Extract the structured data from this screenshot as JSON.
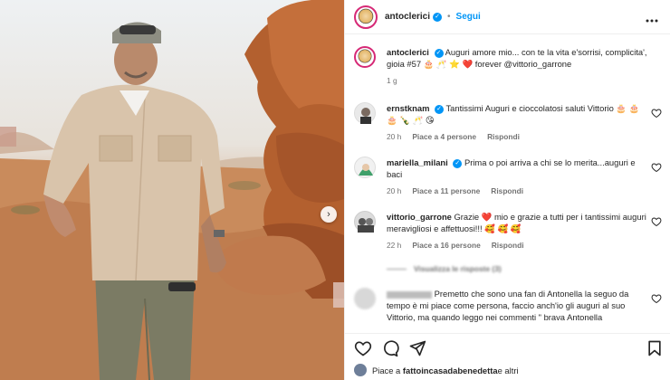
{
  "post": {
    "author": "antoclerici",
    "follow_label": "Segui",
    "caption_text": "Auguri amore mio... con te la vita e'sorrisi, complicita', gioia #57 🎂 🥂 ⭐ ❤️ forever @vittorio_garrone",
    "time": "1 g"
  },
  "comments": [
    {
      "user": "ernstknam",
      "text": "Tantissimi Auguri e cioccolatosi saluti Vittorio 🎂 🎂 🎂 🍾 🥂 😘",
      "time": "20 h",
      "likes": "Piace a 4 persone",
      "reply": "Rispondi"
    },
    {
      "user": "mariella_milani",
      "text": "Prima o poi arriva a chi se lo merita...auguri e baci",
      "time": "20 h",
      "likes": "Piace a 11 persone",
      "reply": "Rispondi"
    },
    {
      "user": "vittorio_garrone",
      "text": "Grazie ❤️ mio e grazie a tutti per i tantissimi auguri meravigliosi e affettuosi!!! 🥰 🥰 🥰",
      "time": "22 h",
      "likes": "Piace a 16 persone",
      "reply": "Rispondi"
    }
  ],
  "view_replies": "Visualizza le risposte (3)",
  "long_comment": {
    "text": "Premetto che sono una fan di Antonella la seguo da tempo è mi piace come persona, faccio anch'io gli auguri al suo Vittorio, ma quando leggo nei commenti \" brava Antonella"
  },
  "liked_by": {
    "prefix": "Piace a ",
    "user": "fattoincasadabenedetta",
    "suffix": " e altri"
  },
  "icons": {
    "heart": "heart-icon",
    "comment": "comment-icon",
    "share": "share-icon",
    "save": "bookmark-icon",
    "more": "more-icon",
    "verified": "verified-badge-icon"
  },
  "colors": {
    "accent": "#0095f6",
    "like_red": "#ed4956"
  }
}
